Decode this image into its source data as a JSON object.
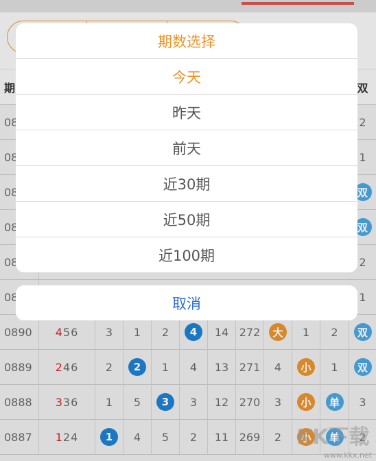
{
  "dialog": {
    "title": "期数选择",
    "options": [
      "今天",
      "昨天",
      "前天",
      "近30期",
      "近50期",
      "近100期"
    ],
    "selected_index": 0,
    "cancel_label": "取消"
  },
  "table": {
    "header_left": "期",
    "header_right": "双",
    "partial_rows": [
      {
        "issue": "08",
        "right": "2"
      },
      {
        "issue": "08",
        "right": "1"
      },
      {
        "issue": "08",
        "right": "双"
      },
      {
        "issue": "08",
        "right": "双"
      },
      {
        "issue": "08",
        "right": "2"
      },
      {
        "issue": "08",
        "right": "1"
      }
    ],
    "rows": [
      {
        "issue": "0890",
        "nums": [
          "4",
          "5",
          "6"
        ],
        "c1": "3",
        "c2": "1",
        "c3": "2",
        "c4": "4",
        "sum": "14",
        "total": "272",
        "c5": "大",
        "c6": "1",
        "c7": "2",
        "c8": "双"
      },
      {
        "issue": "0889",
        "nums": [
          "2",
          "4",
          "6"
        ],
        "c1": "2",
        "c2": "2",
        "c3": "1",
        "c4": "4",
        "sum": "13",
        "total": "271",
        "c5": "4",
        "c6": "小",
        "c7": "1",
        "c8": "双"
      },
      {
        "issue": "0888",
        "nums": [
          "3",
          "3",
          "6"
        ],
        "c1": "1",
        "c2": "5",
        "c3": "3",
        "c4": "3",
        "sum": "12",
        "total": "270",
        "c5": "3",
        "c6": "小",
        "c7": "单",
        "c8": "3"
      },
      {
        "issue": "0887",
        "nums": [
          "1",
          "2",
          "4"
        ],
        "c1": "1",
        "c2": "4",
        "c3": "5",
        "c4": "2",
        "sum": "11",
        "total": "269",
        "c5": "2",
        "c6": "小",
        "c7": "单",
        "c8": "2"
      }
    ]
  },
  "watermark": {
    "logo": "KK下载",
    "url": "www.kkx.net"
  },
  "colors": {
    "accent": "#e8962a",
    "cancel": "#2e6fd1",
    "ball_blue": "#1e7fd0",
    "ball_orange": "#e6912f"
  }
}
